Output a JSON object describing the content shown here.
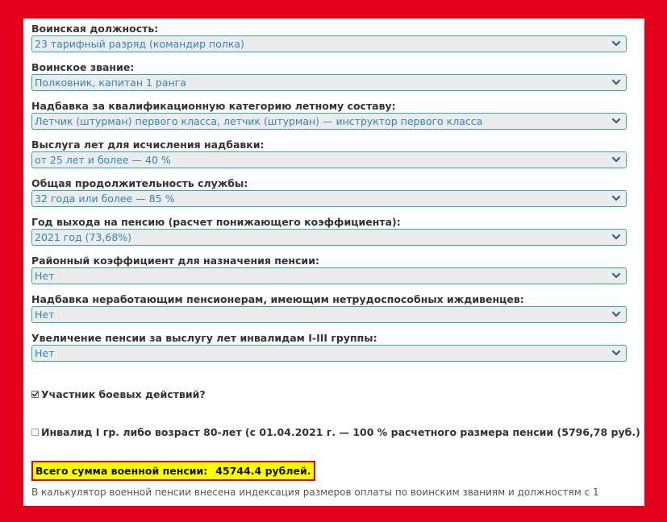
{
  "fields": [
    {
      "label": "Воинская должность:",
      "value": "23 тарифный разряд (командир полка)"
    },
    {
      "label": "Воинское звание:",
      "value": "Полковник, капитан 1 ранга"
    },
    {
      "label": "Надбавка за квалификационную категорию летному составу:",
      "value": "Летчик (штурман) первого класса, летчик (штурман) — инструктор первого класса"
    },
    {
      "label": "Выслуга лет для исчисления надбавки:",
      "value": "от 25 лет и более — 40 %"
    },
    {
      "label": "Общая продолжительность службы:",
      "value": "32 года или более — 85 %"
    },
    {
      "label": "Год выхода на пенсию (расчет понижающего коэффициента):",
      "value": "2021 год (73,68%)"
    },
    {
      "label": "Районный коэффициент для назначения пенсии:",
      "value": "Нет"
    },
    {
      "label": "Надбавка неработающим пенсионерам, имеющим нетрудоспособных иждивенцев:",
      "value": "Нет"
    },
    {
      "label": "Увеличение пенсии за выслугу лет инвалидам I-III группы:",
      "value": "Нет"
    }
  ],
  "checkboxes": [
    {
      "label": "Участник боевых действий?",
      "checked": true
    },
    {
      "label": "Инвалид I гр. либо возраст 80-лет (с 01.04.2021 г. — 100 % расчетного размера пенсии (5796,78 руб.)",
      "checked": false
    }
  ],
  "total": {
    "label": "Всего сумма военной пенсии:",
    "value": "45744.4 рублей."
  },
  "note": "В калькулятор военной пенсии внесена индексация размеров оплаты по воинским званиям и должностям с 1",
  "colors": {
    "frame": "#e3001b",
    "select_border": "#37a6b4",
    "select_text": "#2e86c1",
    "total_highlight": "#ffff00"
  }
}
